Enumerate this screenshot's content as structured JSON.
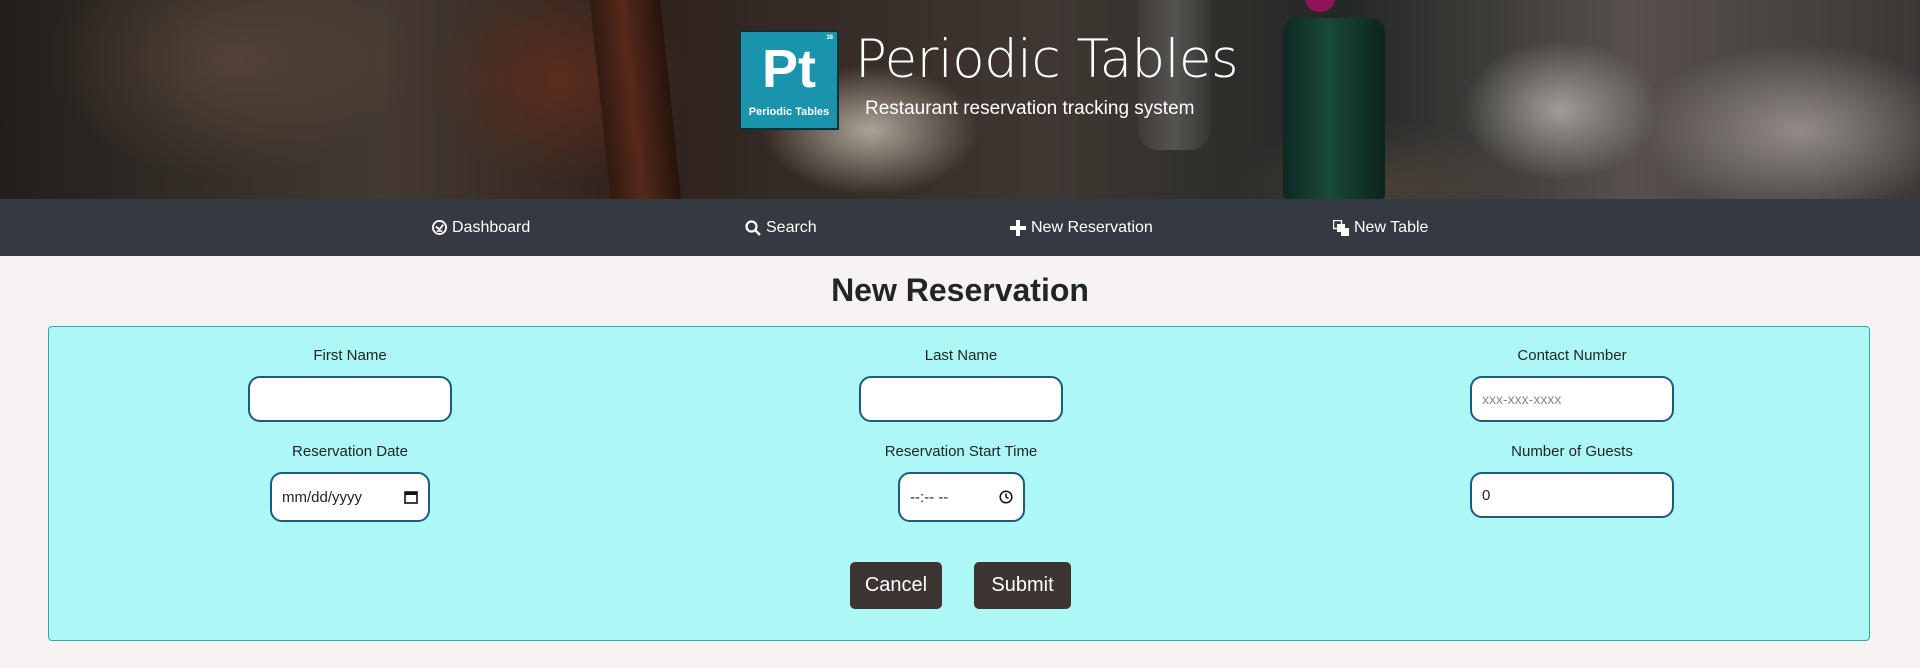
{
  "header": {
    "logo": {
      "symbol": "Pt",
      "number": "38",
      "caption": "Periodic Tables"
    },
    "title": "Periodic Tables",
    "subtitle": "Restaurant reservation tracking system"
  },
  "nav": {
    "items": [
      {
        "label": "Dashboard",
        "icon": "dashboard-icon"
      },
      {
        "label": "Search",
        "icon": "search-icon"
      },
      {
        "label": "New Reservation",
        "icon": "plus-icon"
      },
      {
        "label": "New Table",
        "icon": "layers-icon"
      }
    ]
  },
  "page": {
    "title": "New Reservation"
  },
  "form": {
    "first_name": {
      "label": "First Name",
      "value": ""
    },
    "last_name": {
      "label": "Last Name",
      "value": ""
    },
    "contact_number": {
      "label": "Contact Number",
      "value": "",
      "placeholder": "xxx-xxx-xxxx"
    },
    "reservation_date": {
      "label": "Reservation Date",
      "display": "mm/dd/yyyy",
      "icon": "calendar-icon"
    },
    "reservation_time": {
      "label": "Reservation Start Time",
      "display": "--:-- --",
      "icon": "clock-icon"
    },
    "people": {
      "label": "Number of Guests",
      "value": "0"
    },
    "cancel_label": "Cancel",
    "submit_label": "Submit"
  },
  "colors": {
    "nav_bg": "#343a40",
    "form_bg": "#adf7f7",
    "form_border": "#35a7a2",
    "button_bg": "#3e3533",
    "logo_bg": "#1a94ad",
    "page_bg": "#f7f3f3"
  }
}
